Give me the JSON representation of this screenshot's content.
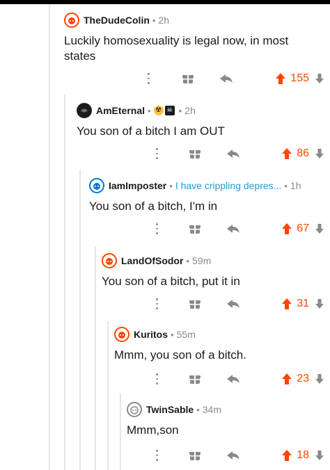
{
  "comments": [
    {
      "username": "TheDudeColin",
      "age": "2h",
      "body": "Luckily homosexuality is legal now, in most states",
      "votes": "155",
      "avatar_color": "#ff4500"
    },
    {
      "username": "AmEternal",
      "age": "2h",
      "body": "You son of a bitch I am OUT",
      "votes": "86",
      "avatar_color": "#1c1c1c"
    },
    {
      "username": "IamImposter",
      "flair": "I have crippling depres...",
      "age": "1h",
      "body": "You son of a bitch, I'm in",
      "votes": "67",
      "avatar_color": "#0079d3"
    },
    {
      "username": "LandOfSodor",
      "age": "59m",
      "body": "You son of a bitch, put it in",
      "votes": "31",
      "avatar_color": "#ff4500"
    },
    {
      "username": "Kuritos",
      "age": "55m",
      "body": "Mmm, you son of a bitch.",
      "votes": "23",
      "avatar_color": "#ff4500"
    },
    {
      "username": "TwinSable",
      "age": "34m",
      "body": "Mmm,son",
      "votes": "18",
      "avatar_color": "#878a8c"
    }
  ],
  "colors": {
    "upvote": "#ff4500",
    "downvote": "#878a8c",
    "meta": "#878a8c",
    "flair": "#1f9ecf"
  },
  "icons": [
    "more-icon",
    "gift-icon",
    "reply-icon",
    "upvote-icon",
    "downvote-icon"
  ]
}
